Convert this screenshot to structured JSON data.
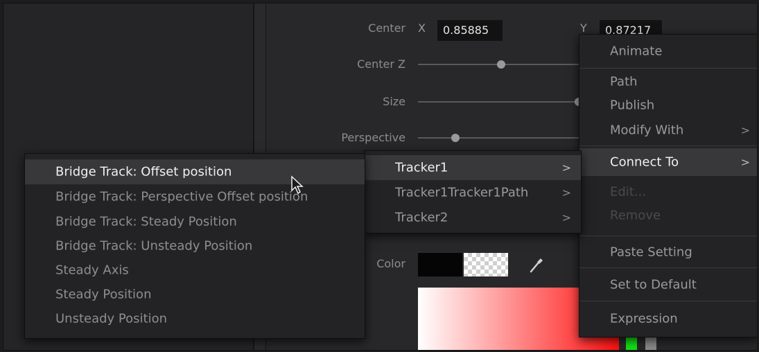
{
  "inspector": {
    "center_label": "Center",
    "x_label": "X",
    "x_value": "0.85885",
    "y_label": "Y",
    "y_value": "0.87217",
    "center_z_label": "Center Z",
    "size_label": "Size",
    "perspective_label": "Perspective",
    "color_label": "Color"
  },
  "context_menu": {
    "items": [
      {
        "label": "Animate",
        "enabled": true
      },
      {
        "label": "Path",
        "enabled": true
      },
      {
        "label": "Publish",
        "enabled": true
      },
      {
        "label": "Modify With",
        "enabled": true
      },
      {
        "label": "Connect To",
        "enabled": true
      },
      {
        "label": "Edit...",
        "enabled": false
      },
      {
        "label": "Remove",
        "enabled": false
      },
      {
        "label": "Paste Setting",
        "enabled": true
      },
      {
        "label": "Set to Default",
        "enabled": true
      },
      {
        "label": "Expression",
        "enabled": true
      }
    ],
    "submenu_arrow": ">"
  },
  "tracker_menu": {
    "items": [
      {
        "label": "Tracker1"
      },
      {
        "label": "Tracker1Tracker1Path"
      },
      {
        "label": "Tracker2"
      }
    ]
  },
  "bridge_menu": {
    "items": [
      {
        "label": "Bridge Track: Offset position"
      },
      {
        "label": "Bridge Track: Perspective Offset position"
      },
      {
        "label": "Bridge Track: Steady Position"
      },
      {
        "label": "Bridge Track: Unsteady Position"
      },
      {
        "label": "Steady Axis"
      },
      {
        "label": "Steady Position"
      },
      {
        "label": "Unsteady Position"
      }
    ]
  },
  "colors": {
    "menu_bg": "#232325",
    "highlight": "#38383a",
    "green_swatch": "#14e014",
    "red_gradient_end": "#ff1010"
  }
}
